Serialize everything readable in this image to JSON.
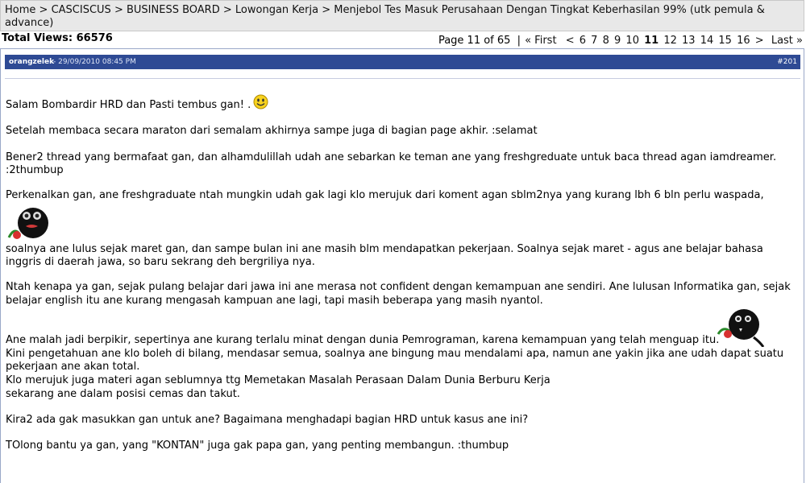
{
  "breadcrumb": {
    "items": [
      "Home",
      "CASCISCUS",
      "BUSINESS BOARD",
      "Lowongan Kerja",
      "Menjebol Tes Masuk Perusahaan Dengan Tingkat Keberhasilan 99% (utk pemula &",
      "advance)"
    ],
    "separator": ">"
  },
  "stats": {
    "total_views": "Total Views: 66576"
  },
  "pagination": {
    "label": "Page 11 of 65",
    "divider": "|",
    "first": "« First",
    "prev": "<",
    "pages": [
      "6",
      "7",
      "8",
      "9",
      "10",
      "11",
      "12",
      "13",
      "14",
      "15",
      "16"
    ],
    "current": "11",
    "next": ">",
    "last": "Last »"
  },
  "post": {
    "author": "orangzelek",
    "date": " - 29/09/2010 08:45 PM",
    "number": "#201",
    "lines": [
      "Salam Bombardir HRD dan Pasti tembus gan! .",
      "Setelah membaca secara maraton dari semalam akhirnya sampe juga di bagian page akhir. :selamat",
      "Bener2 thread yang bermafaat gan, dan alhamdulillah udah ane sebarkan ke teman ane yang freshgreduate untuk baca thread agan iamdreamer.",
      ":2thumbup",
      "Perkenalkan gan, ane freshgraduate ntah mungkin udah gak lagi klo merujuk dari koment agan sblm2nya yang kurang lbh 6 bln perlu waspada,",
      "soalnya ane lulus sejak maret gan, dan sampe bulan ini ane masih blm mendapatkan pekerjaan. Soalnya sejak maret - agus ane belajar bahasa",
      "inggris di daerah jawa, so baru sekrang deh bergriliya nya.",
      "Ntah kenapa ya gan, sejak pulang belajar dari jawa ini ane merasa not confident dengan kemampuan ane sendiri. Ane lulusan Informatika gan, sejak",
      "belajar english itu ane kurang mengasah kampuan ane lagi, tapi masih beberapa yang masih nyantol.",
      "Ane malah jadi berpikir, sepertinya ane kurang terlalu minat dengan dunia Pemrograman, karena kemampuan yang telah menguap itu.",
      "Kini pengetahuan ane klo boleh di bilang, mendasar semua, soalnya ane bingung mau mendalami apa, namun ane yakin jika ane udah dapat suatu",
      "pekerjaan ane akan total.",
      "Klo merujuk juga materi agan seblumnya ttg Memetakan Masalah Perasaan Dalam Dunia Berburu Kerja",
      "sekarang ane dalam posisi cemas dan takut.",
      "Kira2 ada gak masukkan gan untuk ane? Bagaimana menghadapi bagian HRD untuk kasus ane ini?",
      "TOlong bantu ya gan, yang \"KONTAN\" juga gak papa gan, yang penting membangun. :thumbup"
    ]
  },
  "colors": {
    "breadcrumb_bg": "#e8e8e8",
    "post_header_bg": "#2e4a94",
    "post_border": "#9aa8c8"
  },
  "icons": [
    "smiley-icon",
    "black-blob-emoticon-icon"
  ]
}
